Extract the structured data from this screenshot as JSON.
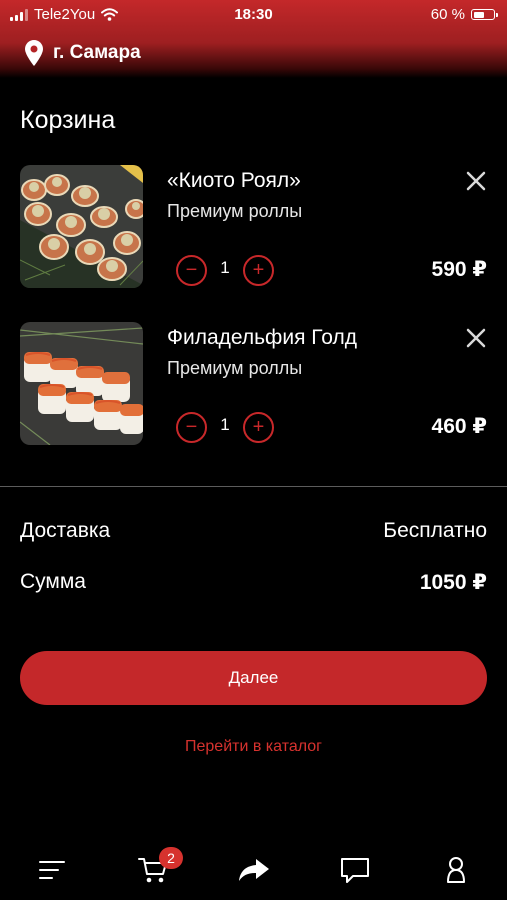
{
  "status_bar": {
    "carrier": "Tele2You",
    "time": "18:30",
    "battery": "60 %",
    "battery_level": 0.6
  },
  "header": {
    "city": "г. Самара"
  },
  "cart": {
    "title": "Корзина",
    "items": [
      {
        "name": "«Киото Роял»",
        "category": "Премиум роллы",
        "quantity": "1",
        "price": "590 ₽"
      },
      {
        "name": "Филадельфия Голд",
        "category": "Премиум роллы",
        "quantity": "1",
        "price": "460 ₽"
      }
    ]
  },
  "summary": {
    "delivery_label": "Доставка",
    "delivery_value": "Бесплатно",
    "total_label": "Сумма",
    "total_value": "1050 ₽"
  },
  "actions": {
    "next_label": "Далее",
    "catalog_link": "Перейти в каталог"
  },
  "tab_bar": {
    "cart_badge": "2",
    "tabs": [
      "menu-icon",
      "cart-icon",
      "share-icon",
      "chat-icon",
      "profile-icon"
    ]
  },
  "colors": {
    "accent": "#c4282a",
    "background": "#000000",
    "text": "#ffffff"
  }
}
